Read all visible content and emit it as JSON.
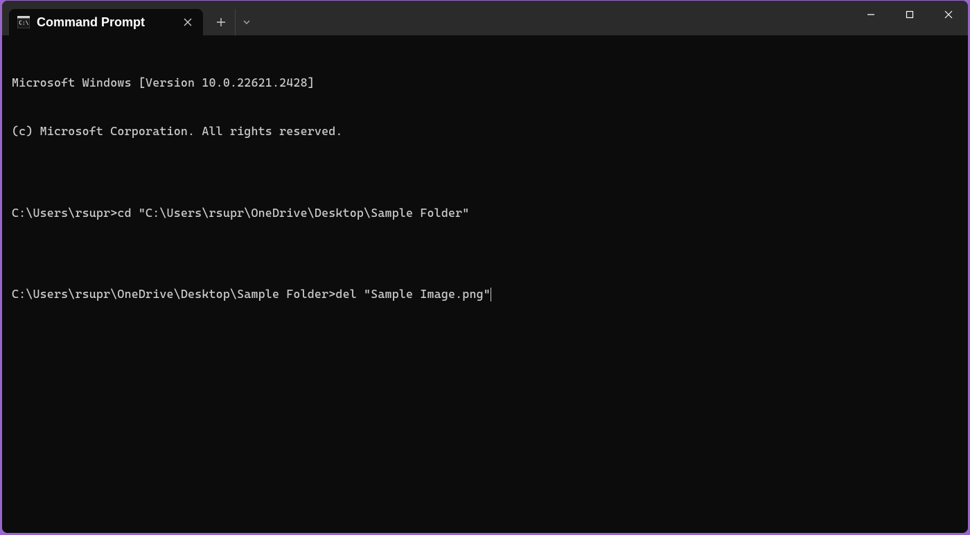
{
  "window": {
    "tab": {
      "title": "Command Prompt"
    }
  },
  "terminal": {
    "lines": [
      "Microsoft Windows [Version 10.0.22621.2428]",
      "(c) Microsoft Corporation. All rights reserved.",
      "",
      "C:\\Users\\rsupr>cd \"C:\\Users\\rsupr\\OneDrive\\Desktop\\Sample Folder\"",
      ""
    ],
    "current_prompt": "C:\\Users\\rsupr\\OneDrive\\Desktop\\Sample Folder>",
    "current_input": "del \"Sample Image.png\""
  }
}
